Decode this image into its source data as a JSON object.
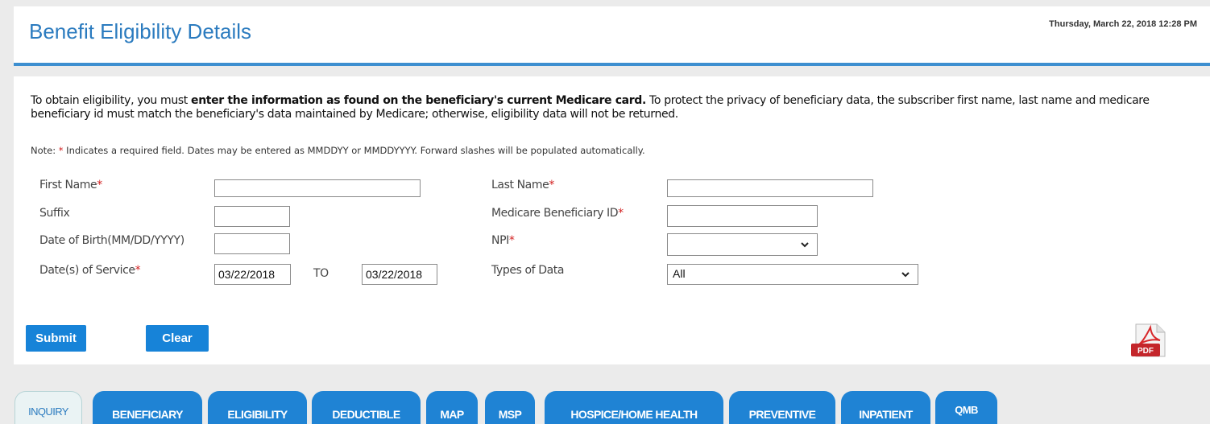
{
  "header": {
    "title": "Benefit Eligibility Details",
    "datetime": "Thursday, March 22, 2018 12:28 PM"
  },
  "intro": {
    "part1": "To obtain eligibility, you must ",
    "bold": "enter the information as found on the beneficiary's current Medicare card.",
    "part2": " To protect the privacy of beneficiary data, the subscriber first name, last name and medicare beneficiary id must match the beneficiary's data maintained by Medicare; otherwise, eligibility data will not be returned."
  },
  "note": {
    "prefix": "Note: ",
    "star": "*",
    "text": " Indicates a required field. Dates may be entered as MMDDYY or MMDDYYYY. Forward slashes will be populated automatically."
  },
  "form": {
    "required_marker": "*",
    "first_name_label": "First Name",
    "first_name_value": "",
    "suffix_label": "Suffix",
    "suffix_value": "",
    "dob_label": "Date of Birth(MM/DD/YYYY)",
    "dob_value": "",
    "dos_label": "Date(s) of Service",
    "dos_from": "03/22/2018",
    "to_label": "TO",
    "dos_to": "03/22/2018",
    "last_name_label": "Last Name",
    "last_name_value": "",
    "mbi_label": "Medicare Beneficiary ID",
    "mbi_value": "",
    "npi_label": "NPI",
    "npi_value": "",
    "types_label": "Types of Data",
    "types_value": "All"
  },
  "buttons": {
    "submit": "Submit",
    "clear": "Clear"
  },
  "pdf_icon": {
    "icon": "pdf-icon",
    "label": "PDF"
  },
  "tabs": [
    "INQUIRY",
    "BENEFICIARY",
    "ELIGIBILITY",
    "DEDUCTIBLE",
    "MAP",
    "MSP",
    "HOSPICE/HOME HEALTH",
    "PREVENTIVE",
    "INPATIENT",
    "QMB"
  ],
  "colors": {
    "accent": "#2b7bbf",
    "button": "#1783d8",
    "required": "#d21f1f",
    "tab": "#1f83d4",
    "active_tab_bg": "#eaf3f4"
  }
}
